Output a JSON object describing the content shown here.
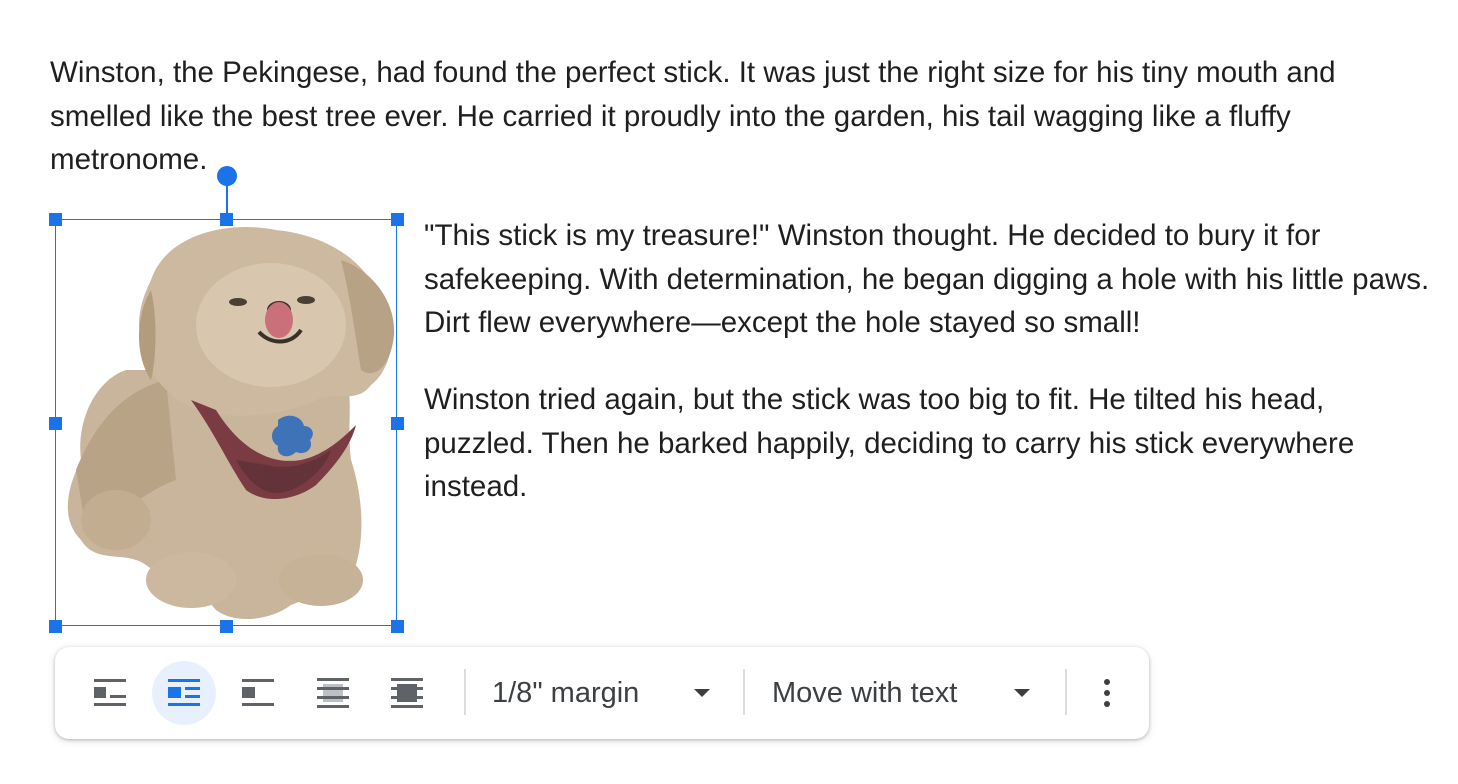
{
  "document": {
    "paragraphs": [
      "Winston, the Pekingese, had found the perfect stick. It was just the right size for his tiny mouth and smelled like the best tree ever. He carried it proudly into the garden, his tail wagging like a fluffy metronome.",
      "\"This stick is my treasure!\" Winston thought. He decided to bury it for safekeeping. With determination, he began digging a hole with his little paws. Dirt flew everywhere—except the hole stayed so small!",
      "Winston tried again, but the stick was too big to fit. He tilted his head, puzzled. Then he barked happily, deciding to carry his stick everywhere instead."
    ]
  },
  "image": {
    "subject": "pekingese-dog",
    "selected": true
  },
  "toolbar": {
    "wrap_options": [
      {
        "icon": "in-line-icon",
        "active": false
      },
      {
        "icon": "wrap-text-icon",
        "active": true
      },
      {
        "icon": "break-text-icon",
        "active": false
      },
      {
        "icon": "behind-text-icon",
        "active": false
      },
      {
        "icon": "in-front-of-text-icon",
        "active": false
      }
    ],
    "margin_label": "1/8\" margin",
    "position_label": "Move with text",
    "more_icon": "more-vert-icon"
  },
  "colors": {
    "selection": "#1a73e8",
    "active_bg": "#e8f0fe",
    "icon": "#5f6368"
  }
}
